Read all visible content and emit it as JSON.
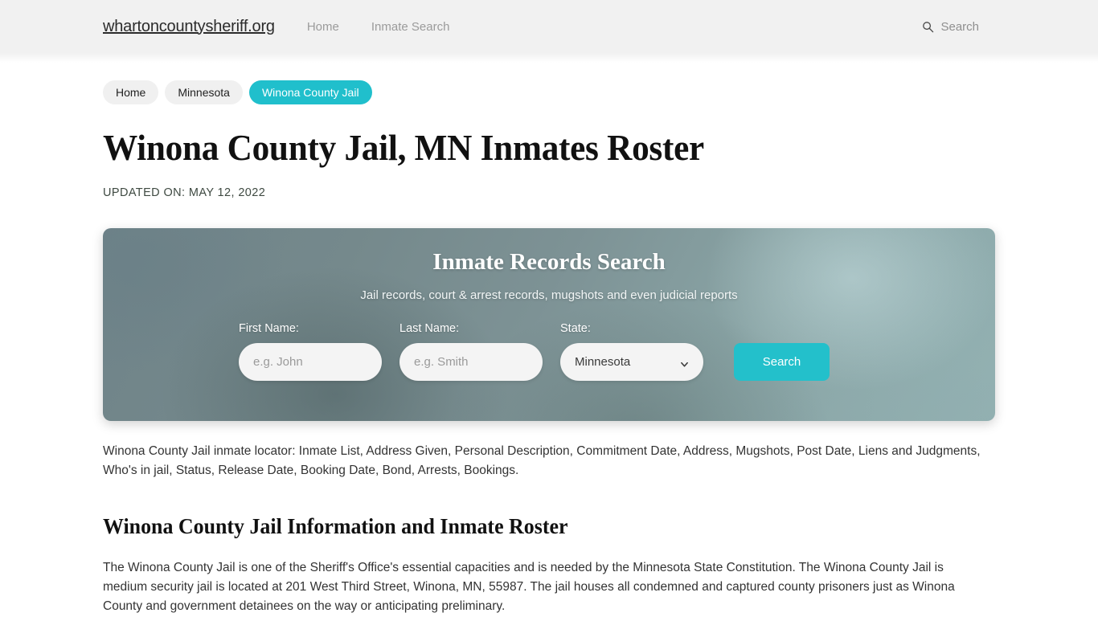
{
  "header": {
    "brand": "whartoncountysheriff.org",
    "nav": [
      {
        "label": "Home"
      },
      {
        "label": "Inmate Search"
      }
    ],
    "search": {
      "icon": "search-icon",
      "label": "Search"
    }
  },
  "breadcrumb": [
    {
      "label": "Home",
      "active": false
    },
    {
      "label": "Minnesota",
      "active": false
    },
    {
      "label": "Winona County Jail",
      "active": true
    }
  ],
  "page": {
    "title": "Winona County Jail, MN Inmates Roster",
    "updated": "UPDATED ON: MAY 12, 2022"
  },
  "panel": {
    "title": "Inmate Records Search",
    "subtitle": "Jail records, court & arrest records, mugshots and even judicial reports",
    "fields": {
      "first_name": {
        "label": "First Name:",
        "placeholder": "e.g. John",
        "value": ""
      },
      "last_name": {
        "label": "Last Name:",
        "placeholder": "e.g. Smith",
        "value": ""
      },
      "state": {
        "label": "State:",
        "selected": "Minnesota",
        "options": [
          "Minnesota"
        ],
        "caret_icon": "chevron-down-icon"
      }
    },
    "submit_label": "Search"
  },
  "main": {
    "locator_text": "Winona County Jail inmate locator: Inmate List, Address Given, Personal Description, Commitment Date, Address, Mugshots, Post Date, Liens and Judgments, Who's in jail, Status, Release Date, Booking Date, Bond, Arrests, Bookings.",
    "section_title": "Winona County Jail Information and Inmate Roster",
    "body_text": "The Winona County Jail is one of the Sheriff's Office's essential capacities and is needed by the Minnesota State Constitution. The Winona County Jail is medium security jail is located at 201 West Third Street, Winona, MN, 55987. The jail houses all condemned and captured county prisoners just as Winona County and government detainees on the way or anticipating preliminary."
  },
  "colors": {
    "accent_teal": "#20bfcc",
    "button_teal": "#23c0cb",
    "header_bg": "#f1f1f1",
    "pill_bg": "#f0f0f0",
    "panel_mid": "#7d9295"
  }
}
